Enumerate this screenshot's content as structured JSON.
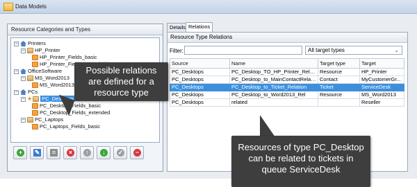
{
  "window": {
    "title": "Data Models"
  },
  "left_panel": {
    "header": "Resource Categories and Types",
    "tree": [
      {
        "label": "Printers",
        "kind": "category"
      },
      {
        "label": "HP_Printer",
        "kind": "type"
      },
      {
        "label": "HP_Printer_Fields_basic",
        "kind": "field"
      },
      {
        "label": "HP_Printer_Fields_extended",
        "kind": "field"
      },
      {
        "label": "OfficeSoftware",
        "kind": "category"
      },
      {
        "label": "MS_Word2013",
        "kind": "type"
      },
      {
        "label": "MS_Word2013_Fields",
        "kind": "field"
      },
      {
        "label": "PCs",
        "kind": "category"
      },
      {
        "label": "PC_Desktops",
        "kind": "type",
        "selected": true
      },
      {
        "label": "PC_Desktop_Fields_basic",
        "kind": "field"
      },
      {
        "label": "PC_Desktop_Fields_extended",
        "kind": "field"
      },
      {
        "label": "PC_Laptops",
        "kind": "type"
      },
      {
        "label": "PC_Laptops_Fields_basic",
        "kind": "field"
      }
    ],
    "toolbar": [
      {
        "name": "add",
        "icon": "plus-icon",
        "color": "#3aa63a"
      },
      {
        "name": "edit",
        "icon": "edit-icon",
        "color": "#3b7bd3"
      },
      {
        "name": "properties",
        "icon": "list-icon",
        "color": "#8c8c8c"
      },
      {
        "name": "delete",
        "icon": "x-icon",
        "color": "#d9363e"
      },
      {
        "name": "move-up",
        "icon": "arrow-up-icon",
        "color": "#9aa0a6"
      },
      {
        "name": "move-down",
        "icon": "arrow-down-icon",
        "color": "#3aa63a"
      },
      {
        "name": "apply",
        "icon": "check-icon",
        "color": "#9aa0a6"
      },
      {
        "name": "remove",
        "icon": "minus-icon",
        "color": "#d9363e"
      }
    ]
  },
  "right_panel": {
    "tabs": [
      {
        "label": "Details"
      },
      {
        "label": "Relations",
        "active": true
      }
    ],
    "header": "Resource Type Relations",
    "filter_label": "Filter:",
    "filter_value": "",
    "type_filter": "All target types",
    "columns": [
      "Source",
      "Name",
      "Target type",
      "Target"
    ],
    "rows": [
      [
        "PC_Desktops",
        "PC_Desktop_TO_HP_Printer_Relation",
        "Resource",
        "HP_Printer"
      ],
      [
        "PC_Desktops",
        "PC_Desktop_to_MainContactRelation",
        "Contact",
        "MyCustomerGr..."
      ],
      [
        "PC_Desktops",
        "PC_Desktop_to_Ticket_Relation",
        "Ticket",
        "ServiceDesk"
      ],
      [
        "PC_Desktops",
        "PC_Desktop_to_Word2013_Rel",
        "Resource",
        "MS_Word2013"
      ],
      [
        "PC_Desktops",
        "related",
        "",
        "Reseller"
      ]
    ],
    "selected_row": 2
  },
  "callouts": {
    "left": [
      "Possible relations",
      "are defined for a",
      "resource type"
    ],
    "right": [
      "Resources of type PC_Desktop",
      "can be related to tickets in",
      "queue ServiceDesk"
    ]
  }
}
